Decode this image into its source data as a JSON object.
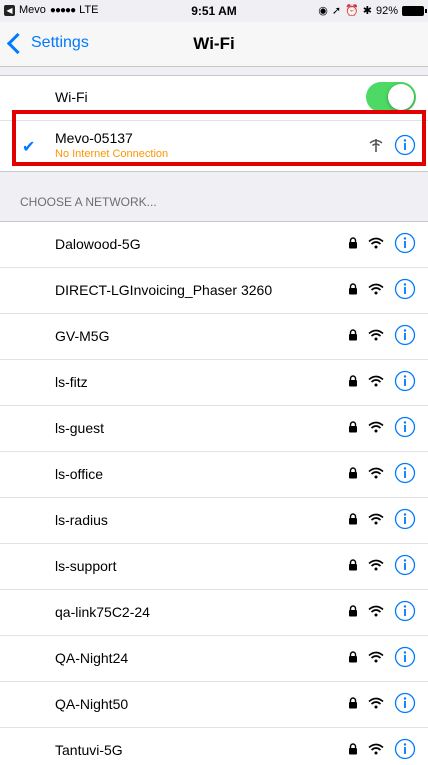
{
  "status_bar": {
    "carrier": "Mevo",
    "signal": "●●●●●",
    "network": "LTE",
    "time": "9:51 AM",
    "battery": "92%"
  },
  "nav": {
    "back_label": "Settings",
    "title": "Wi-Fi"
  },
  "wifi_toggle": {
    "label": "Wi-Fi",
    "on": true
  },
  "connected": {
    "name": "Mevo-05137",
    "status": "No Internet Connection"
  },
  "section_header": "CHOOSE A NETWORK...",
  "networks": [
    {
      "name": "Dalowood-5G"
    },
    {
      "name": "DIRECT-LGInvoicing_Phaser 3260"
    },
    {
      "name": "GV-M5G"
    },
    {
      "name": "ls-fitz"
    },
    {
      "name": "ls-guest"
    },
    {
      "name": "ls-office"
    },
    {
      "name": "ls-radius"
    },
    {
      "name": "ls-support"
    },
    {
      "name": "qa-link75C2-24"
    },
    {
      "name": "QA-Night24"
    },
    {
      "name": "QA-Night50"
    },
    {
      "name": "Tantuvi-5G"
    }
  ],
  "colors": {
    "accent": "#007aff",
    "toggle_on": "#4cd964",
    "warning": "#ff9500",
    "highlight": "#e30000"
  },
  "icons": {
    "lock": "lock-icon",
    "wifi": "wifi-icon",
    "info": "info-icon",
    "no_wifi": "no-wifi-icon"
  }
}
